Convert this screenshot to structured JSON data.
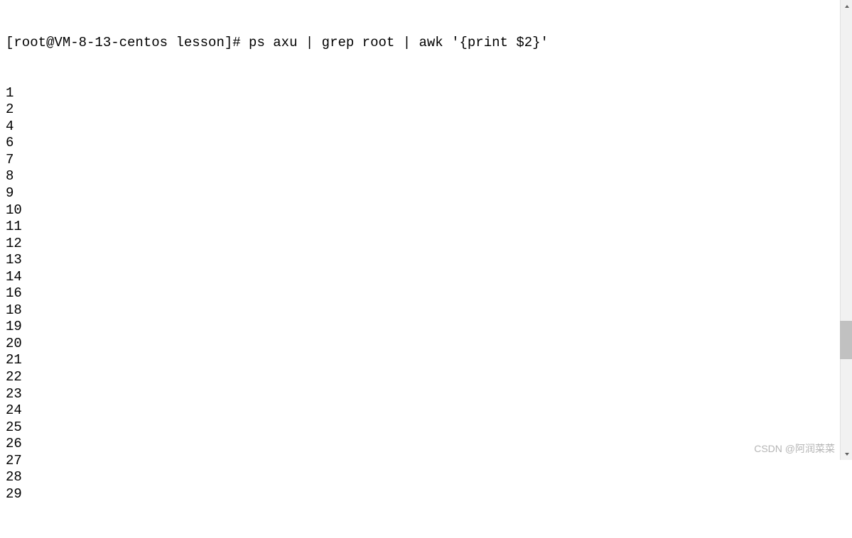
{
  "terminal": {
    "prompt": "[root@VM-8-13-centos lesson]# ps axu | grep root | awk '{print $2}'",
    "output": [
      "1",
      "2",
      "4",
      "6",
      "7",
      "8",
      "9",
      "10",
      "11",
      "12",
      "13",
      "14",
      "16",
      "18",
      "19",
      "20",
      "21",
      "22",
      "23",
      "24",
      "25",
      "26",
      "27",
      "28",
      "29"
    ]
  },
  "watermark": "CSDN @阿润菜菜"
}
